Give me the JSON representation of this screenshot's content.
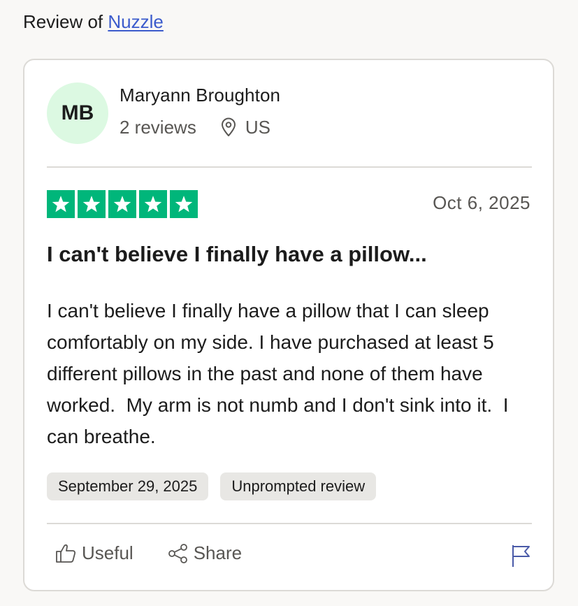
{
  "header": {
    "prefix": "Review of",
    "company_link": "Nuzzle"
  },
  "reviewer": {
    "initials": "MB",
    "name": "Maryann Broughton",
    "reviews_count": "2 reviews",
    "location": "US"
  },
  "review": {
    "rating": 5,
    "rating_color": "#00b67a",
    "date": "Oct 6, 2025",
    "title": "I can't believe I finally have a pillow...",
    "body": "I can't believe I finally have a pillow that I can sleep comfortably on my side. I have purchased at least 5 different pillows in the past and none of them have worked.  My arm is not numb and I don't sink into it.  I can breathe.",
    "tags": [
      "September 29, 2025",
      "Unprompted review"
    ]
  },
  "actions": {
    "useful_label": "Useful",
    "share_label": "Share"
  },
  "icons": {
    "location": "location-pin-icon",
    "useful": "thumbs-up-icon",
    "share": "share-icon",
    "report": "flag-icon"
  },
  "colors": {
    "link": "#3b5bcc",
    "avatar_bg": "#dcf9e2",
    "star_green": "#00b67a",
    "tag_bg": "#e8e7e4",
    "page_bg": "#f9f8f6"
  }
}
